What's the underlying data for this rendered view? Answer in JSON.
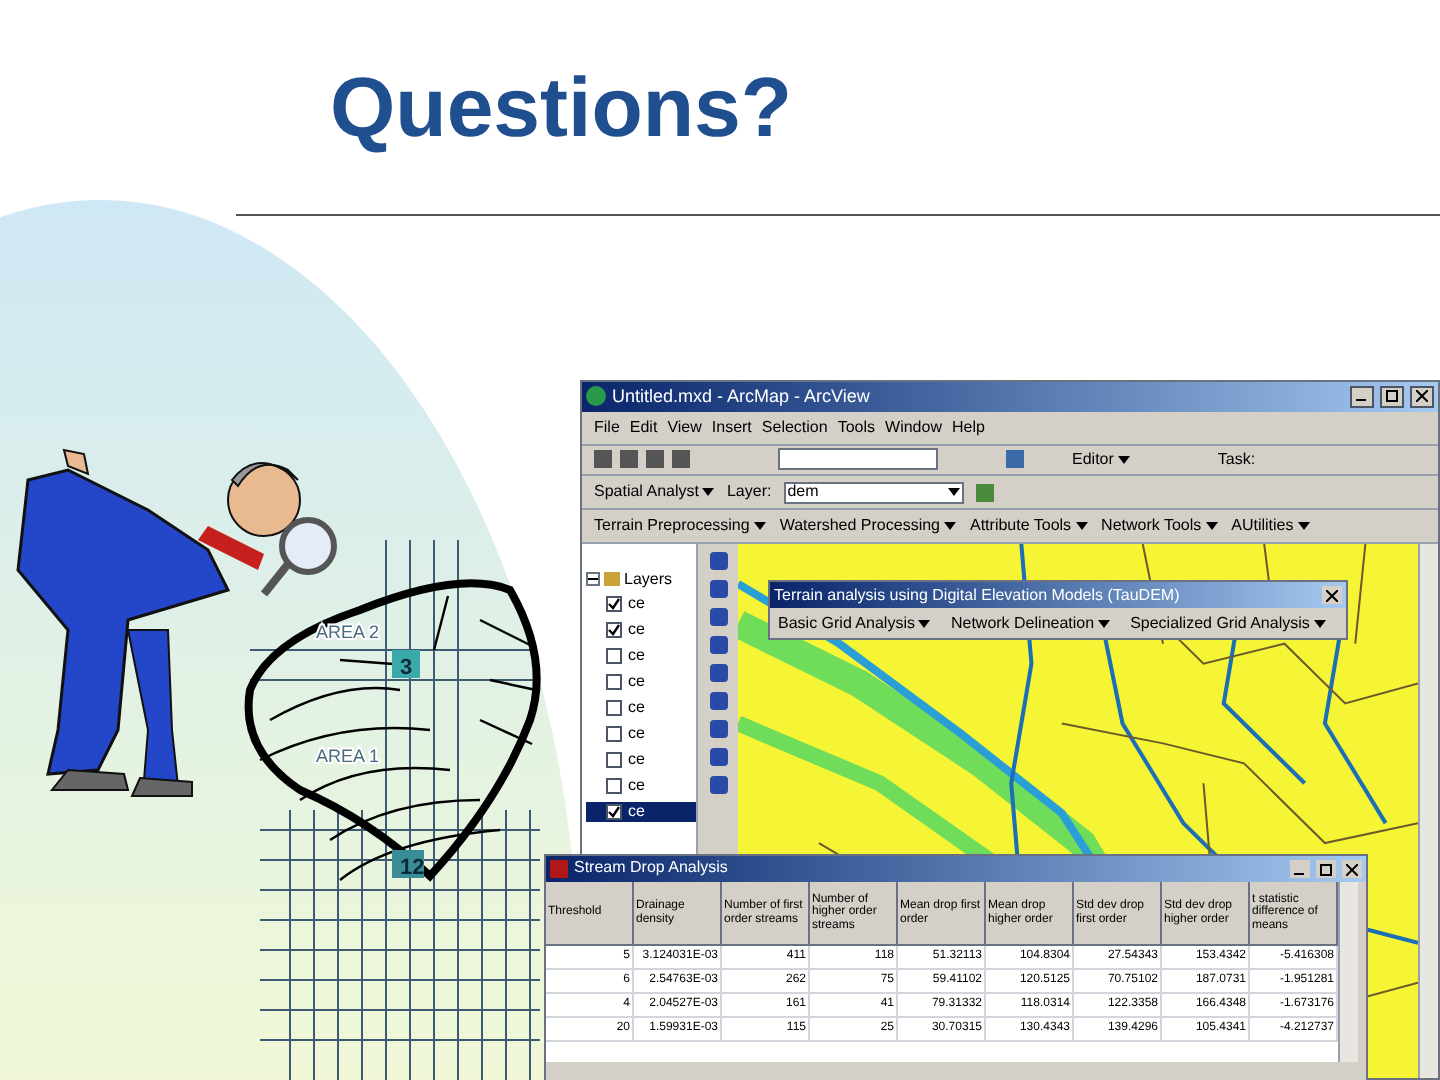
{
  "slide": {
    "title": "Questions?"
  },
  "diagram": {
    "labels": [
      {
        "text": "AREA 2",
        "kind": "area"
      },
      {
        "text": "3",
        "kind": "cell"
      },
      {
        "text": "AREA 1",
        "kind": "area"
      },
      {
        "text": "12",
        "kind": "cell"
      }
    ]
  },
  "arcmap": {
    "title": "Untitled.mxd - ArcMap - ArcView",
    "menu": [
      "File",
      "Edit",
      "View",
      "Insert",
      "Selection",
      "Tools",
      "Window",
      "Help"
    ],
    "editor": "Editor",
    "task": "Task:",
    "spatial_analyst": "Spatial Analyst",
    "layer_label": "Layer:",
    "layer_value": "dem",
    "taudem_menus": [
      "Terrain Preprocessing",
      "Watershed Processing",
      "Attribute Tools",
      "Network Tools",
      "AUtilities"
    ],
    "toc": {
      "root": "Layers",
      "expanded": true,
      "items": [
        {
          "label": "ce",
          "checked": true,
          "selected": false
        },
        {
          "label": "ce",
          "checked": true,
          "selected": false
        },
        {
          "label": "ce",
          "checked": false,
          "selected": false
        },
        {
          "label": "ce",
          "checked": false,
          "selected": false
        },
        {
          "label": "ce",
          "checked": false,
          "selected": false
        },
        {
          "label": "ce",
          "checked": false,
          "selected": false
        },
        {
          "label": "ce",
          "checked": false,
          "selected": false
        },
        {
          "label": "ce",
          "checked": false,
          "selected": false
        },
        {
          "label": "ce",
          "checked": true,
          "selected": true
        }
      ]
    },
    "taudem": {
      "title": "Terrain analysis using Digital Elevation Models (TauDEM)",
      "menus": [
        "Basic Grid Analysis",
        "Network Delineation",
        "Specialized Grid Analysis"
      ]
    }
  },
  "stream_drop": {
    "title": "Stream Drop Analysis",
    "columns": [
      "Threshold",
      "Drainage density",
      "Number of first order streams",
      "Number of higher order streams",
      "Mean drop first order",
      "Mean drop higher order",
      "Std dev drop first order",
      "Std dev drop higher order",
      "t statistic difference of means"
    ],
    "rows": [
      [
        "5",
        "3.124031E-03",
        "411",
        "118",
        "51.32113",
        "104.8304",
        "27.54343",
        "153.4342",
        "-5.416308"
      ],
      [
        "6",
        "2.54763E-03",
        "262",
        "75",
        "59.41102",
        "120.5125",
        "70.75102",
        "187.0731",
        "-1.951281"
      ],
      [
        "4",
        "2.04527E-03",
        "161",
        "41",
        "79.31332",
        "118.0314",
        "122.3358",
        "166.4348",
        "-1.673176"
      ],
      [
        "20",
        "1.59931E-03",
        "115",
        "25",
        "30.70315",
        "130.4343",
        "139.4296",
        "105.4341",
        "-4.212737"
      ]
    ]
  }
}
